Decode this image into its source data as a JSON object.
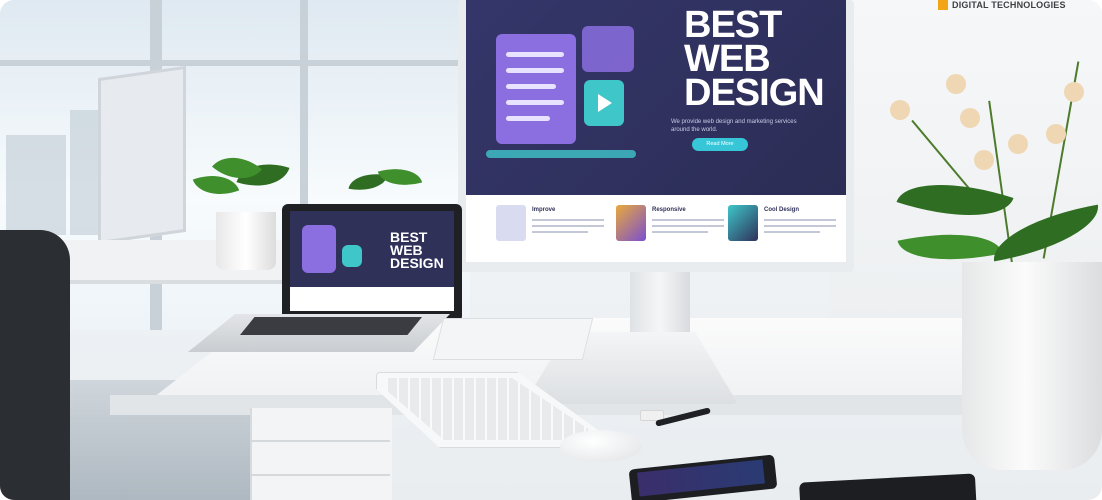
{
  "monitor_screen": {
    "headline": [
      "BEST",
      "WEB",
      "DESIGN"
    ],
    "tagline": "We provide web design and marketing services around the world.",
    "button_label": "Read More",
    "features": [
      {
        "title": "Improve"
      },
      {
        "title": "Responsive"
      },
      {
        "title": "Cool Design"
      }
    ]
  },
  "laptop_screen": {
    "headline": [
      "BEST",
      "WEB",
      "DESIGN"
    ]
  },
  "logo": {
    "text": "DIGITAL TECHNOLOGIES",
    "color": "#f2a516"
  },
  "colors": {
    "screen_bg": "#2f3159",
    "accent_teal": "#37c6d7",
    "accent_purple": "#8b6fe0"
  }
}
